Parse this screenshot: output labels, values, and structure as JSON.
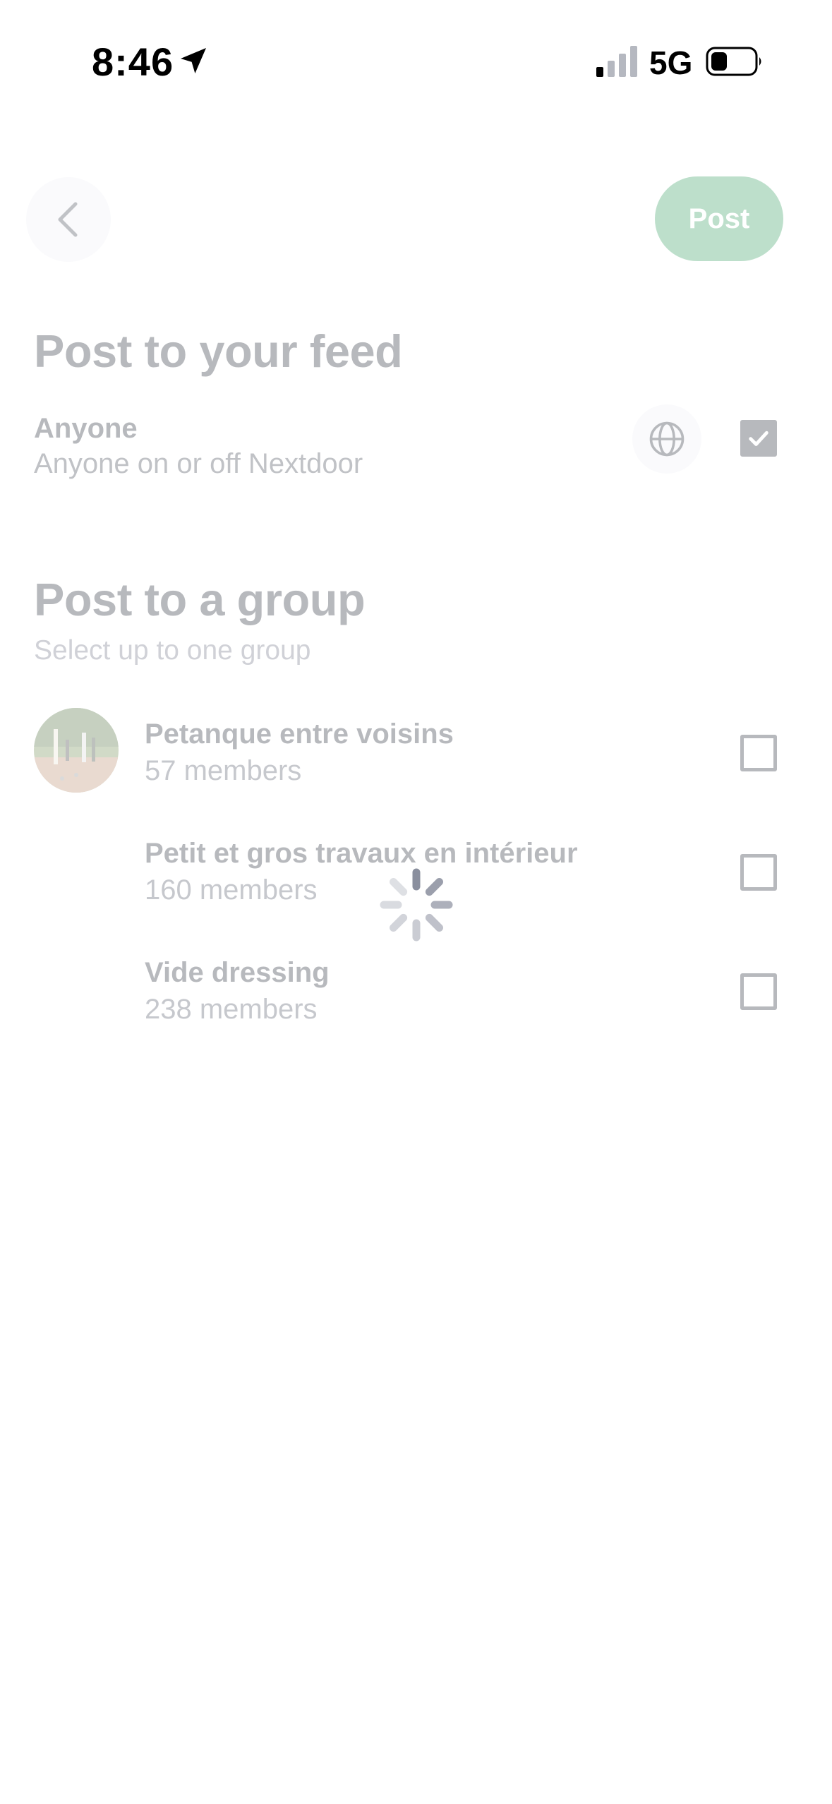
{
  "status_bar": {
    "time": "8:46",
    "network": "5G",
    "location_icon": "location-arrow-icon",
    "signal_icon": "cellular-signal-icon",
    "battery_icon": "battery-icon"
  },
  "nav": {
    "back_icon": "chevron-left-icon",
    "post_label": "Post"
  },
  "feed_section": {
    "title": "Post to your feed",
    "option": {
      "title": "Anyone",
      "subtitle": "Anyone on or off Nextdoor",
      "icon": "globe-icon",
      "checked": true
    }
  },
  "group_section": {
    "title": "Post to a group",
    "subtitle": "Select up to one group",
    "groups": [
      {
        "name": "Petanque entre voisins",
        "members": "57 members",
        "checked": false
      },
      {
        "name": "Petit et gros travaux en intérieur",
        "members": "160 members",
        "checked": false
      },
      {
        "name": "Vide dressing",
        "members": "238 members",
        "checked": false
      }
    ]
  },
  "colors": {
    "accent_green": "#2f9a5c",
    "text_dark": "#1f2430",
    "chip_bg": "#eef0f4",
    "spinner": "#8a8f9e"
  },
  "loading": true
}
